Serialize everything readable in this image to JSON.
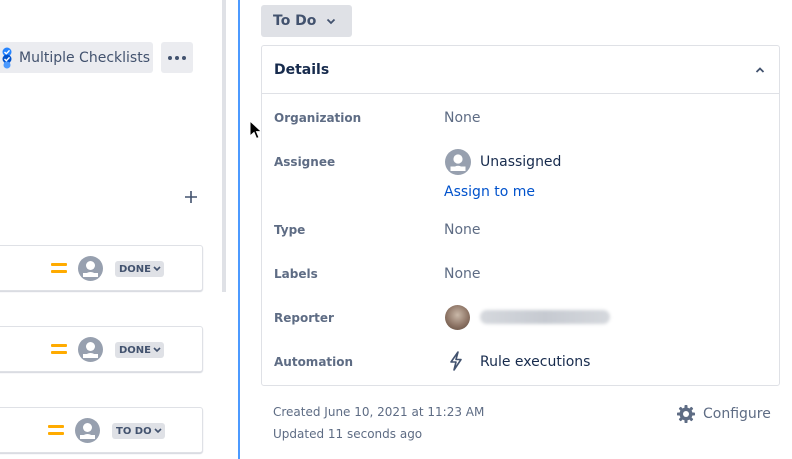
{
  "left": {
    "checklists_label": "Multiple Checklists",
    "cards": [
      {
        "status": "DONE"
      },
      {
        "status": "DONE"
      },
      {
        "status": "TO DO"
      }
    ]
  },
  "status_button": {
    "label": "To Do"
  },
  "details": {
    "title": "Details",
    "organization": {
      "label": "Organization",
      "value": "None"
    },
    "assignee": {
      "label": "Assignee",
      "value": "Unassigned",
      "assign_link": "Assign to me"
    },
    "type": {
      "label": "Type",
      "value": "None"
    },
    "labels": {
      "label": "Labels",
      "value": "None"
    },
    "reporter": {
      "label": "Reporter"
    },
    "automation": {
      "label": "Automation",
      "value": "Rule executions"
    }
  },
  "meta": {
    "created": "Created June 10, 2021 at 11:23 AM",
    "updated": "Updated 11 seconds ago"
  },
  "configure": {
    "label": "Configure"
  },
  "colors": {
    "accent": "#4C9AFF",
    "link": "#0052CC",
    "priority": "#FFAB00",
    "lozenge_bg": "#DFE1E6",
    "text_subtle": "#5E6C84"
  }
}
